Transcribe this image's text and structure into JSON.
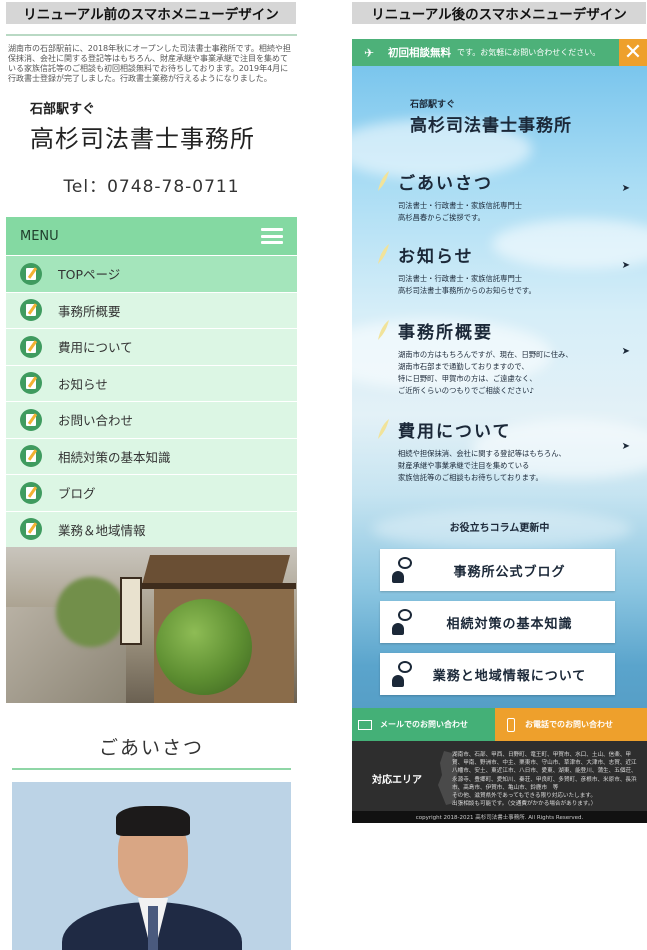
{
  "labels": {
    "before": "リニューアル前のスマホメニューデザイン",
    "after": "リニューアル後のスマホメニューデザイン"
  },
  "before": {
    "intro": "湖南市の石部駅前に、2018年秋にオープンした司法書士事務所です。相続や担保抹消、会社に関する登記等はもちろん、財産承継や事業承継で注目を集めている家族信託等のご相談も初回相談無料でお待ちしております。2019年4月に行政書士登録が完了しました。行政書士業務が行えるようになりました。",
    "sub_title": "石部駅すぐ",
    "title": "高杉司法書士事務所",
    "tel": "Tel：0748-78-0711",
    "menu_label": "MENU",
    "nav": [
      {
        "label": "TOPページ"
      },
      {
        "label": "事務所概要"
      },
      {
        "label": "費用について"
      },
      {
        "label": "お知らせ"
      },
      {
        "label": "お問い合わせ"
      },
      {
        "label": "相続対策の基本知識"
      },
      {
        "label": "ブログ"
      },
      {
        "label": "業務＆地域情報"
      }
    ],
    "greeting": "ごあいさつ"
  },
  "after": {
    "consult_label": "初回相談無料",
    "consult_sub": "です。お気軽にお問い合わせください。",
    "close": "✕",
    "sub_title": "石部駅すぐ",
    "title": "高杉司法書士事務所",
    "sections": [
      {
        "title": "ごあいさつ",
        "text": "司法書士・行政書士・家族信託専門士\n高杉昌春からご挨拶です。",
        "arrow": "➤"
      },
      {
        "title": "お知らせ",
        "text": "司法書士・行政書士・家族信託専門士\n高杉司法書士事務所からのお知らせです。",
        "arrow": "➤"
      },
      {
        "title": "事務所概要",
        "text": "湖南市の方はもちろんですが、現在、日野町に住み、\n湖南市石部まで通勤しておりますので、\n特に日野町、甲賀市の方は、ご遠慮なく、\nご近所くらいのつもりでご相談ください♪",
        "arrow": "➤"
      },
      {
        "title": "費用について",
        "text": "相続や担保抹消、会社に関する登記等はもちろん、\n財産承継や事業承継で注目を集めている\n家族信託等のご相談もお待ちしております。",
        "arrow": "➤"
      }
    ],
    "column_heading": "お役立ちコラム更新中",
    "column_buttons": [
      {
        "label": "事務所公式ブログ"
      },
      {
        "label": "相続対策の基本知識"
      },
      {
        "label": "業務と地域情報について"
      }
    ],
    "contact_mail": "メールでのお問い合わせ",
    "contact_tel": "お電話でのお問い合わせ",
    "area_label": "対応エリア",
    "area_text": "湖南市、石部、甲西、日野町、竜王町、甲賀市、水口、土山、信楽、甲賀、甲南、野洲市、中主、栗東市、守山市、草津市、大津市、志賀、近江八幡市、安土、東近江市、八日市、愛東、湖東、能登川、蒲生、五個荘、永源寺、豊郷町、愛知川、秦荘、甲良町、多賀町、彦根市、米原市、長浜市、高島市、伊賀市、亀山市、鈴鹿市　等\nその他、滋賀県外であってもできる限り対応いたします。\n出張相談も可能です。（交通費がかかる場合があります。）",
    "copyright": "copyright 2018-2021 高杉司法書士事務所. All Rights Reserved."
  }
}
